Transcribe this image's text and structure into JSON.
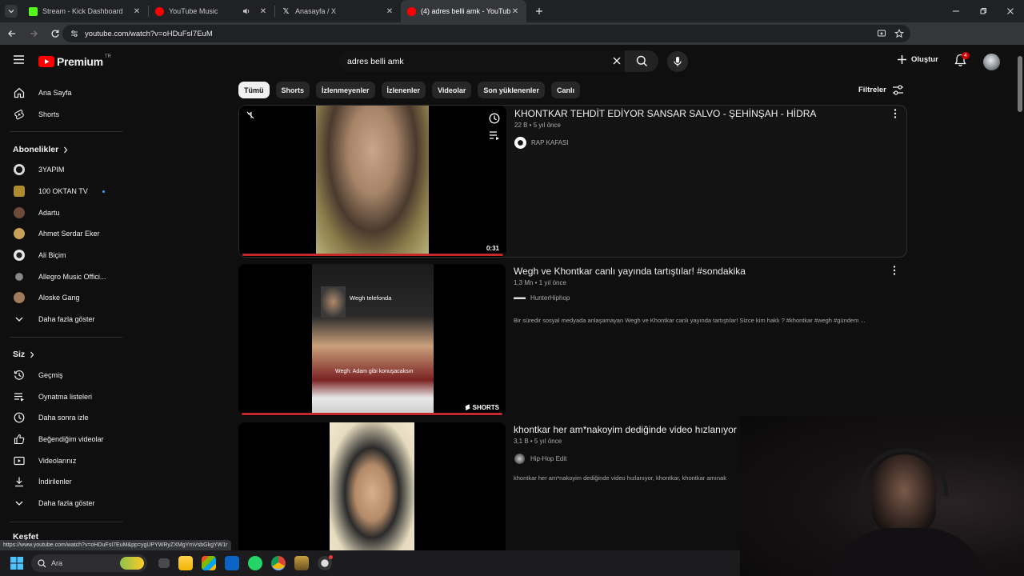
{
  "browser": {
    "tabs": [
      {
        "title": "Stream - Kick Dashboard",
        "favicon_color": "#53fc18"
      },
      {
        "title": "YouTube Music",
        "favicon_color": "#ff0000"
      },
      {
        "title": "Anasayfa / X",
        "favicon_color": "#000000"
      },
      {
        "title": "(4) adres belli amk - YouTube",
        "favicon_color": "#ff0000"
      }
    ],
    "url": "youtube.com/watch?v=oHDuFsI7EuM",
    "status_url": "https://www.youtube.com/watch?v=oHDuFsI7EuM&pp=ygUPYWRyZXMgYmVsbGkgYW1r"
  },
  "masthead": {
    "logo_text": "Premium",
    "logo_region": "TR",
    "search_value": "adres belli amk",
    "create_label": "Oluştur",
    "notification_count": "4"
  },
  "sidebar": {
    "main": [
      {
        "label": "Ana Sayfa",
        "icon": "home-icon"
      },
      {
        "label": "Shorts",
        "icon": "shorts-icon"
      }
    ],
    "subscriptions_title": "Abonelikler",
    "subscriptions": [
      {
        "label": "3YAPIM",
        "color": "#d9d9d9"
      },
      {
        "label": "100 OKTAN TV",
        "color": "#b08a2e"
      },
      {
        "label": "Adartu",
        "color": "#6e4a3a"
      },
      {
        "label": "Ahmet Serdar Eker",
        "color": "#c9a25a"
      },
      {
        "label": "Ali Biçim",
        "color": "#e6e6e6"
      },
      {
        "label": "Allegro Music Offici...",
        "color": "#888888"
      },
      {
        "label": "Aloske Gang",
        "color": "#a07a5a"
      }
    ],
    "show_more_label": "Daha fazla göster",
    "you_title": "Siz",
    "you_items": [
      {
        "label": "Geçmiş",
        "icon": "history-icon"
      },
      {
        "label": "Oynatma listeleri",
        "icon": "playlists-icon"
      },
      {
        "label": "Daha sonra izle",
        "icon": "watch-later-icon"
      },
      {
        "label": "Beğendiğim videolar",
        "icon": "like-icon"
      },
      {
        "label": "Videolarınız",
        "icon": "your-videos-icon"
      },
      {
        "label": "İndirilenler",
        "icon": "downloads-icon"
      }
    ],
    "show_more_label_2": "Daha fazla göster",
    "explore_title": "Keşfet"
  },
  "chips": [
    "Tümü",
    "Shorts",
    "İzlenmeyenler",
    "İzlenenler",
    "Videolar",
    "Son yüklenenler",
    "Canlı"
  ],
  "filters_label": "Filtreler",
  "results": [
    {
      "title": "KHONTKAR TEHDİT EDİYOR SANSAR SALVO - ŞEHİNŞAH - HİDRA",
      "meta": "22 B • 5 yıl önce",
      "channel": "RAP KAFASI",
      "channel_color": "#ffffff",
      "description": "",
      "duration": "0:31",
      "progress": 1.0
    },
    {
      "title": "Wegh ve Khontkar canlı yayında tartıştılar! #sondakika",
      "meta": "1,3 Mn • 1 yıl önce",
      "channel": "HunterHiphop",
      "channel_color": "#dddddd",
      "description": "Bir süredir sosyal medyada anlaşamayan Wegh ve Khontkar canlı yayında tartıştılar! Sizce kim haklı ? #khontkar #wegh #gündem ...",
      "badge": "SHORTS",
      "caption_top": "Wegh telefonda",
      "caption_bottom": "Wegh: Adam gibi konuşacaksın",
      "progress": 1.0
    },
    {
      "title": "khontkar her am*nakoyim dediğinde video hızlanıyor",
      "meta": "3,1 B • 5 yıl önce",
      "channel": "Hip-Hop Edit",
      "channel_color": "#cccccc",
      "description": "khontkar her am*nakoyim dediğinde video hızlanıyor, khontkar, khontkar amınak"
    }
  ],
  "taskbar": {
    "search_placeholder": "Ara"
  }
}
